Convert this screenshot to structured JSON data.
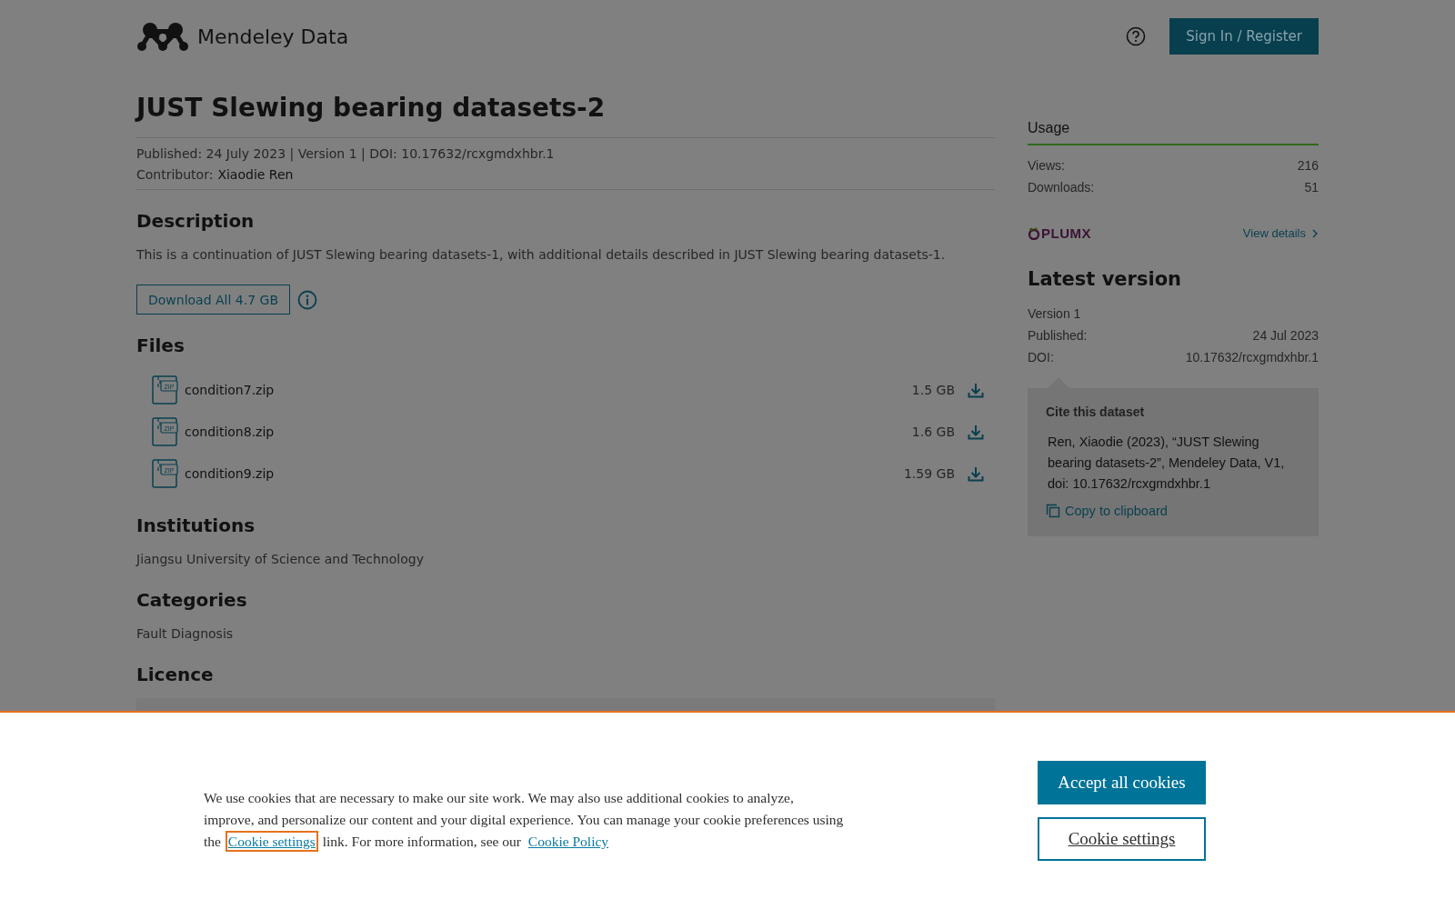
{
  "header": {
    "logo_text": "Mendeley Data",
    "sign_in": "Sign In / Register"
  },
  "dataset": {
    "title": "JUST Slewing bearing datasets-2",
    "meta": "Published: 24 July 2023 | Version 1 | DOI: 10.17632/rcxgmdxhbr.1",
    "contributor_label": "Contributor:",
    "contributor": "Xiaodie Ren"
  },
  "description": {
    "heading": "Description",
    "text": "This is a continuation of JUST Slewing bearing datasets-1, with additional details described in  JUST Slewing bearing datasets-1.",
    "download_all": "Download All 4.7 GB"
  },
  "files": {
    "heading": "Files",
    "items": [
      {
        "name": "condition7.zip",
        "size": "1.5 GB",
        "type_label": "ZIP"
      },
      {
        "name": "condition8.zip",
        "size": "1.6 GB",
        "type_label": "ZIP"
      },
      {
        "name": "condition9.zip",
        "size": "1.59 GB",
        "type_label": "ZIP"
      }
    ]
  },
  "institutions": {
    "heading": "Institutions",
    "text": "Jiangsu University of Science and Technology"
  },
  "categories": {
    "heading": "Categories",
    "text": "Fault Diagnosis"
  },
  "licence": {
    "heading": "Licence"
  },
  "sidebar": {
    "usage_heading": "Usage",
    "stats": [
      {
        "label": "Views:",
        "value": "216"
      },
      {
        "label": "Downloads:",
        "value": "51"
      }
    ],
    "plumx_logo": "PLUMX",
    "view_details": "View details",
    "latest_heading": "Latest version",
    "version": "Version 1",
    "rows": [
      {
        "label": "Published:",
        "value": "24 Jul 2023"
      },
      {
        "label": "DOI:",
        "value": "10.17632/rcxgmdxhbr.1"
      }
    ],
    "cite_heading": "Cite this dataset",
    "citation": "Ren, Xiaodie (2023), “JUST Slewing bearing datasets-2”, Mendeley Data, V1, doi: 10.17632/rcxgmdxhbr.1",
    "copy": "Copy to clipboard"
  },
  "cookie_banner": {
    "text_before": "We use cookies that are necessary to make our site work. We may also use additional cookies to analyze, improve, and personalize our content and your digital experience. You can manage your cookie preferences using the ",
    "settings_link": {
      "label": "Cookie settings",
      "focused": true
    },
    "text_middle": " link. For more information, see our ",
    "policy_link": "Cookie Policy",
    "accept": "Accept all cookies",
    "settings_button": "Cookie settings"
  }
}
